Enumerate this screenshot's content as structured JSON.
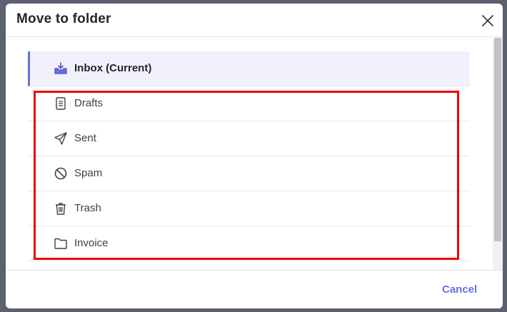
{
  "dialog": {
    "title": "Move to folder",
    "cancel_label": "Cancel"
  },
  "folders": [
    {
      "label": "Inbox (Current)",
      "icon": "inbox-icon",
      "current": true
    },
    {
      "label": "Drafts",
      "icon": "document-icon",
      "current": false
    },
    {
      "label": "Sent",
      "icon": "paper-plane-icon",
      "current": false
    },
    {
      "label": "Spam",
      "icon": "block-icon",
      "current": false
    },
    {
      "label": "Trash",
      "icon": "trash-icon",
      "current": false
    },
    {
      "label": "Invoice",
      "icon": "folder-icon",
      "current": false
    }
  ],
  "colors": {
    "accent": "#6a6fe0",
    "annotation_box": "#f00000",
    "backdrop": "#5c6170"
  }
}
